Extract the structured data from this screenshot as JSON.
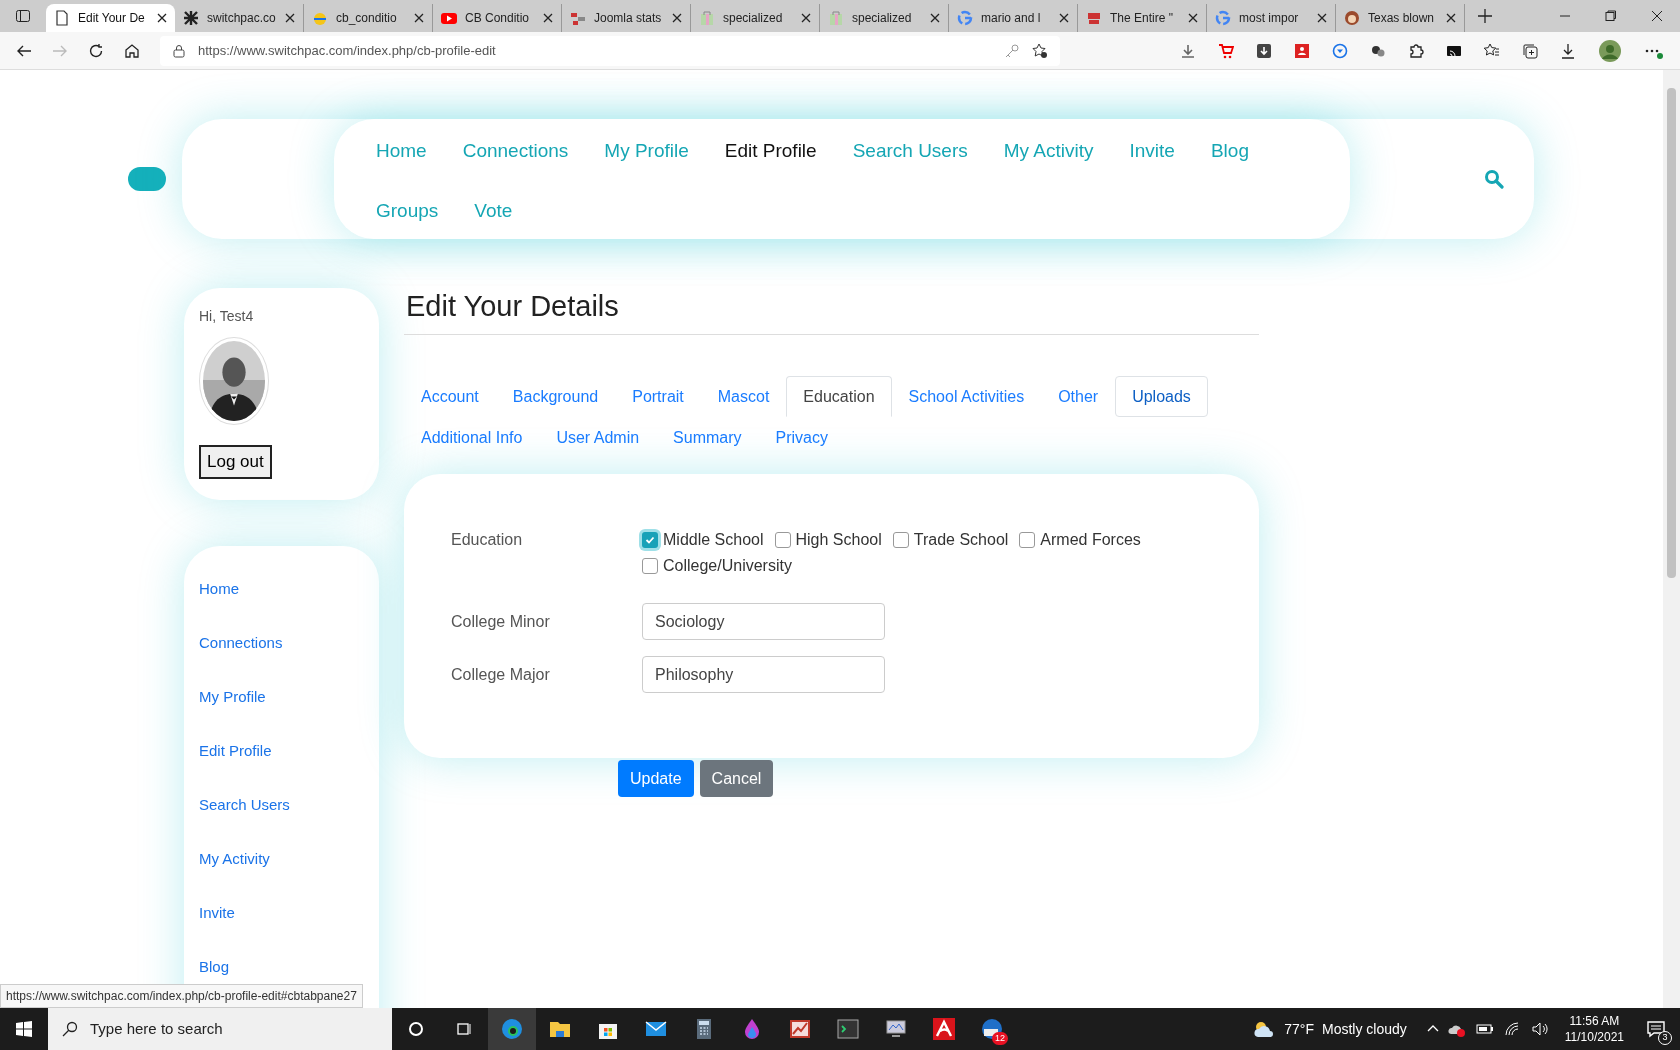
{
  "browser": {
    "tabs": [
      {
        "title": "Edit Your De",
        "selected": true
      },
      {
        "title": "switchpac.co",
        "selected": false
      },
      {
        "title": "cb_conditio",
        "selected": false
      },
      {
        "title": "CB Conditio",
        "selected": false
      },
      {
        "title": "Joomla stats",
        "selected": false
      },
      {
        "title": "specialized",
        "selected": false
      },
      {
        "title": "specialized",
        "selected": false
      },
      {
        "title": "mario and l",
        "selected": false
      },
      {
        "title": "The Entire \"",
        "selected": false
      },
      {
        "title": "most impor",
        "selected": false
      },
      {
        "title": "Texas blown",
        "selected": false
      }
    ],
    "url": "https://www.switchpac.com/index.php/cb-profile-edit"
  },
  "nav": {
    "items": [
      {
        "label": "Home",
        "selected": false
      },
      {
        "label": "Connections",
        "selected": false
      },
      {
        "label": "My Profile",
        "selected": false
      },
      {
        "label": "Edit Profile",
        "selected": true
      },
      {
        "label": "Search Users",
        "selected": false
      },
      {
        "label": "My Activity",
        "selected": false
      },
      {
        "label": "Invite",
        "selected": false
      },
      {
        "label": "Blog",
        "selected": false
      },
      {
        "label": "Groups",
        "selected": false
      },
      {
        "label": "Vote",
        "selected": false
      }
    ]
  },
  "user_card": {
    "greeting": "Hi, Test4",
    "logout": "Log out"
  },
  "sidebar": {
    "items": [
      "Home",
      "Connections",
      "My Profile",
      "Edit Profile",
      "Search Users",
      "My Activity",
      "Invite",
      "Blog"
    ]
  },
  "page_title": "Edit Your Details",
  "tabs": [
    {
      "label": "Account",
      "selected": false,
      "focused": false
    },
    {
      "label": "Background",
      "selected": false,
      "focused": false
    },
    {
      "label": "Portrait",
      "selected": false,
      "focused": false
    },
    {
      "label": "Mascot",
      "selected": false,
      "focused": false
    },
    {
      "label": "Education",
      "selected": true,
      "focused": false
    },
    {
      "label": "School Activities",
      "selected": false,
      "focused": false
    },
    {
      "label": "Other",
      "selected": false,
      "focused": false
    },
    {
      "label": "Uploads",
      "selected": false,
      "focused": true
    },
    {
      "label": "Additional Info",
      "selected": false,
      "focused": false
    },
    {
      "label": "User Admin",
      "selected": false,
      "focused": false
    },
    {
      "label": "Summary",
      "selected": false,
      "focused": false
    },
    {
      "label": "Privacy",
      "selected": false,
      "focused": false
    }
  ],
  "form": {
    "education": {
      "label": "Education",
      "options": [
        {
          "label": "Middle School",
          "checked": true
        },
        {
          "label": "High School",
          "checked": false
        },
        {
          "label": "Trade School",
          "checked": false
        },
        {
          "label": "Armed Forces",
          "checked": false
        },
        {
          "label": "College/University",
          "checked": false
        }
      ]
    },
    "fields": [
      {
        "label": "College Minor",
        "value": "Sociology"
      },
      {
        "label": "College Major",
        "value": "Philosophy"
      }
    ],
    "buttons": [
      {
        "label": "Update",
        "kind": "primary"
      },
      {
        "label": "Cancel",
        "kind": "secondary"
      }
    ]
  },
  "status_url": "https://www.switchpac.com/index.php/cb-profile-edit#cbtabpane27",
  "taskbar": {
    "search_placeholder": "Type here to search",
    "mail_badge": "12",
    "weather_temp": "77°F",
    "weather_text": "Mostly cloudy",
    "time": "11:56 AM",
    "date": "11/10/2021",
    "notifications": "3"
  }
}
